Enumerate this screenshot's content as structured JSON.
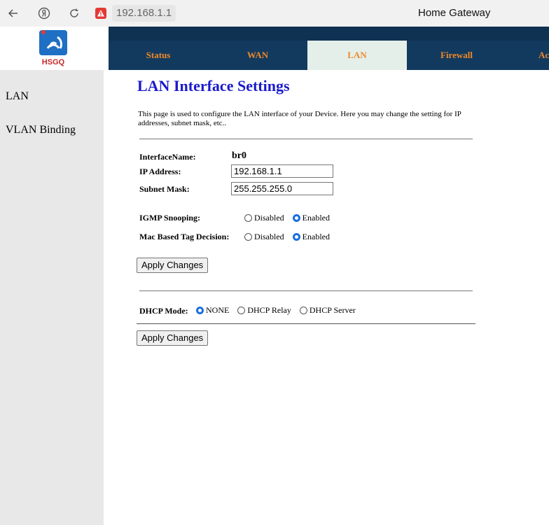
{
  "browser": {
    "url": "192.168.1.1",
    "tab_title": "Home Gateway"
  },
  "logo": {
    "text": "HSGQ"
  },
  "nav": {
    "tabs": [
      {
        "label": "Status"
      },
      {
        "label": "WAN"
      },
      {
        "label": "LAN",
        "active": true
      },
      {
        "label": "Firewall"
      },
      {
        "label": "Ac"
      }
    ]
  },
  "sidebar": {
    "items": [
      {
        "label": "LAN"
      },
      {
        "label": "VLAN Binding"
      }
    ]
  },
  "main": {
    "title": "LAN Interface Settings",
    "description": "This page is used to configure the LAN interface of your Device. Here you may change the setting for IP addresses, subnet mask, etc..",
    "interface_name_label": "InterfaceName:",
    "interface_name_value": "br0",
    "ip_label": "IP Address:",
    "ip_value": "192.168.1.1",
    "mask_label": "Subnet Mask:",
    "mask_value": "255.255.255.0",
    "igmp_label": "IGMP Snooping:",
    "igmp_options": [
      "Disabled",
      "Enabled"
    ],
    "igmp_selected": "Enabled",
    "mac_label": "Mac Based Tag Decision:",
    "mac_options": [
      "Disabled",
      "Enabled"
    ],
    "mac_selected": "Enabled",
    "apply_label": "Apply Changes",
    "dhcp_label": "DHCP Mode:",
    "dhcp_options": [
      "NONE",
      "DHCP Relay",
      "DHCP Server"
    ],
    "dhcp_selected": "NONE",
    "apply_label_2": "Apply Changes"
  }
}
